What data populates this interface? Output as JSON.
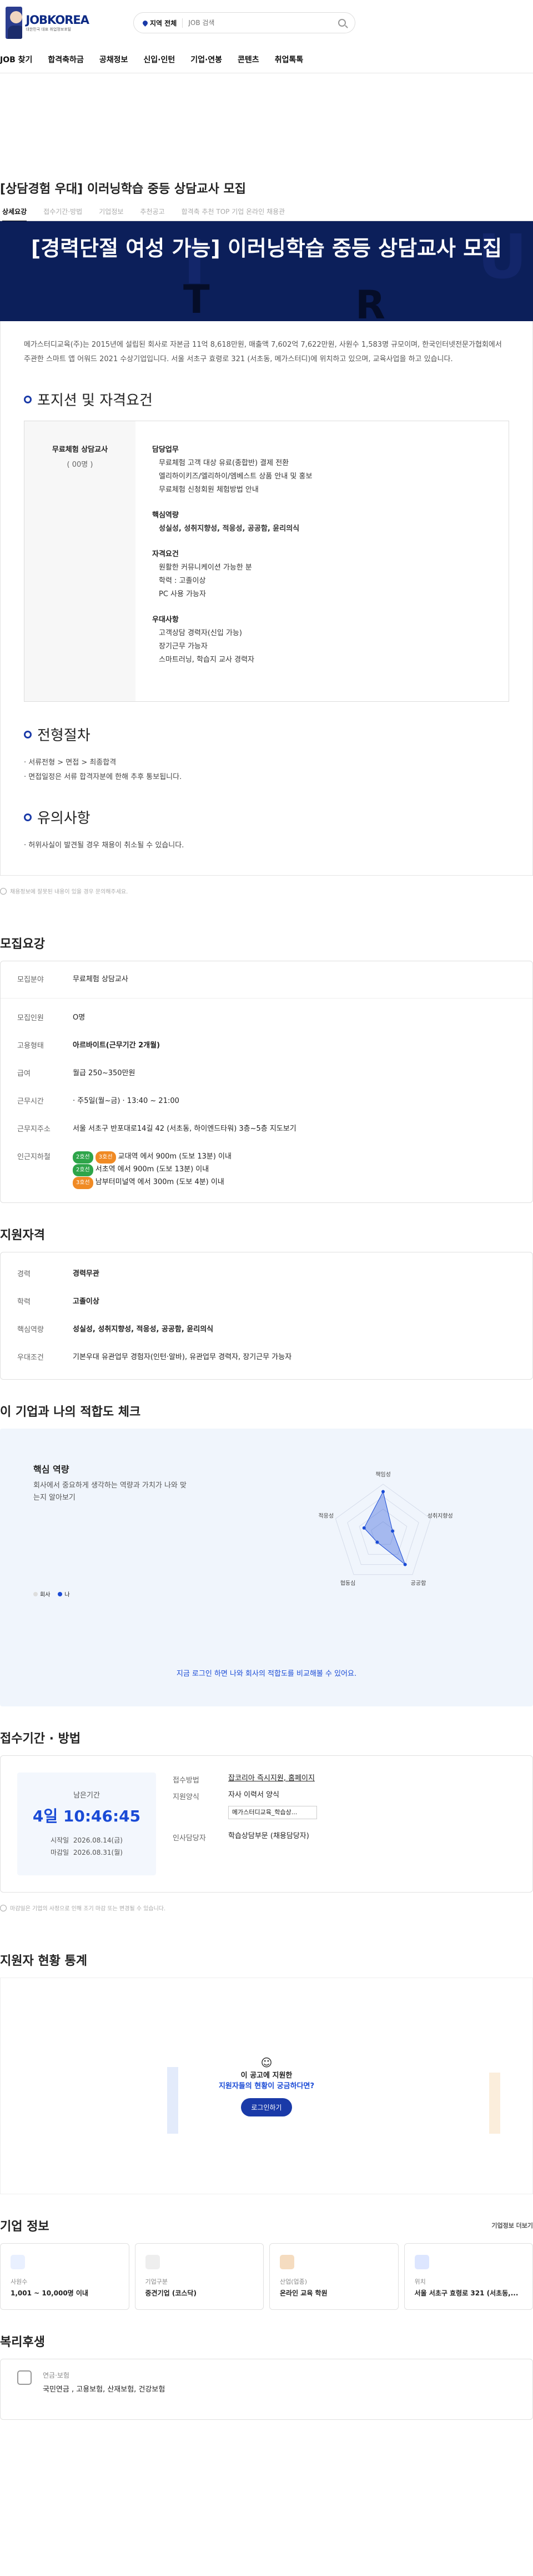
{
  "header": {
    "brand": "JOBKOREA",
    "slogan": "대한민국 대표 취업정보포털",
    "region": "지역 전체",
    "search_placeholder": "JOB 검색"
  },
  "gnb": [
    "JOB 찾기",
    "합격축하금",
    "공채정보",
    "신입·인턴",
    "기업·연봉",
    "콘텐츠",
    "취업톡톡"
  ],
  "job": {
    "title": "[상담경험 우대] 이러닝학습 중등 상담교사 모집",
    "tabs": [
      "상세요강",
      "접수기간·방법",
      "기업정보",
      "추천공고",
      "합격축 추천 TOP 기업 온라인 채용관"
    ]
  },
  "banner": {
    "title": "[경력단절 여성 가능] 이러닝학습 중등 상담교사 모집",
    "letters": [
      "T",
      "R",
      "U"
    ]
  },
  "intro": "메가스터디교육(주)는 2015년에 설립된 회사로 자본금 11억 8,618만원, 매출액 7,602억 7,622만원, 사원수 1,583명 규모이며, 한국인터넷전문가협회에서 주관한 스마트 앱 어워드 2021 수상기업입니다. 서울 서초구 효령로 321 (서초동, 메가스터디)에 위치하고 있으며, 교육사업을 하고 있습니다.",
  "position": {
    "heading": "포지션 및 자격요건",
    "name": "무료체험 상담교사",
    "count": "( 00명 )",
    "blocks": [
      {
        "title": "담당업무",
        "items": [
          "무료체험 고객 대상 유료(종합반) 결제 전환",
          "엘리하이키즈/엘리하이/엠베스트 상품 안내 및 홍보",
          "무료체험 신청회원 체험방법 안내"
        ]
      },
      {
        "title": "핵심역량",
        "items": [
          "성실성, 성취지향성, 적응성, 공공함, 윤리의식"
        ]
      },
      {
        "title": "자격요건",
        "items": [
          "원활한 커뮤니케이션 가능한 분",
          "학력 : 고졸이상",
          "PC 사용 가능자"
        ]
      },
      {
        "title": "우대사항",
        "items": [
          "고객상담 경력자(신입 가능)",
          "장기근무 가능자",
          "스마트러닝, 학습지 교사 경력자"
        ]
      }
    ]
  },
  "process": {
    "heading": "전형절차",
    "lines": [
      "· 서류전형 > 면접 > 최종합격",
      "· 면접일정은 서류 합격자분에 한해 추후 통보됩니다."
    ]
  },
  "notes": {
    "heading": "유의사항",
    "lines": [
      "· 허위사실이 발견될 경우 채용이 취소될 수 있습니다."
    ],
    "report": "채용정보에 잘못된 내용이 있을 경우 문의해주세요."
  },
  "summary": {
    "heading": "모집요강",
    "rows": [
      {
        "k": "모집분야",
        "v": "무료체험 상담교사"
      },
      {
        "k": "모집인원",
        "v": "O명"
      },
      {
        "k": "고용형태",
        "v": "아르바이트(근무기간 2개월)"
      },
      {
        "k": "급여",
        "v": "월급 250~350만원"
      },
      {
        "k": "근무시간",
        "v": "· 주5일(월~금)  · 13:40 ~ 21:00"
      },
      {
        "k": "근무지주소",
        "v": "서울 서초구 반포대로14길 42 (서초동, 하이엔드타워) 3층~5층  지도보기"
      }
    ],
    "station_label": "인근지하철",
    "stations": [
      {
        "line": "2호선",
        "sub": "3호선",
        "text": "교대역 에서 900m (도보 13분) 이내"
      },
      {
        "line": "2호선",
        "text": "서초역 에서 900m (도보 13분) 이내"
      },
      {
        "line": "3호선",
        "text": "남부터미널역 에서 300m (도보 4분) 이내"
      }
    ]
  },
  "qualify": {
    "heading": "지원자격",
    "rows": [
      {
        "k": "경력",
        "v": "경력무관"
      },
      {
        "k": "학력",
        "v": "고졸이상"
      },
      {
        "k": "핵심역량",
        "v": "성실성, 성취지향성, 적응성, 공공함, 윤리의식"
      },
      {
        "k": "우대조건",
        "v": "기본우대  유관업무 경험자(인턴·알바), 유관업무 경력자, 장기근무 가능자"
      }
    ]
  },
  "fit": {
    "heading": "이 기업과 나의 적합도 체크",
    "title": "핵심 역량",
    "desc": "회사에서 중요하게 생각하는 역량과 가치가 나와 맞는지 알아보기",
    "axes": [
      "책임성",
      "성취지향성",
      "공공함",
      "협동심",
      "적응성"
    ],
    "legend_company": "회사",
    "legend_me": "나",
    "company_values": [
      0.85,
      0.2,
      0.75,
      0.2,
      0.4
    ],
    "footer": "지금 로그인 하면 나와 회사의 적합도를 비교해볼 수 있어요."
  },
  "apply": {
    "heading": "접수기간 · 방법",
    "remain_label": "남은기간",
    "remain": "4일 10:46:45",
    "start_label": "시작일",
    "start": "2026.08.14(금)",
    "end_label": "마감일",
    "end": "2026.08.31(월)",
    "rows": [
      {
        "k": "접수방법",
        "v": "잡코리아 즉시지원, 홈페이지"
      },
      {
        "k": "지원양식",
        "v": "자사 이력서 양식"
      },
      {
        "k": "",
        "v": "메가스터디교육_학습상..."
      },
      {
        "k": "인사담당자",
        "v": "학습상담부문 (채용담당자)"
      }
    ],
    "note": "마감일은 기업의 사정으로 인해 조기 마감 또는 변경될 수 있습니다."
  },
  "stats": {
    "heading": "지원자 현황 통계",
    "q1": "이 공고에 지원한",
    "q2": "지원자들의 현황이 궁금하다면?",
    "btn": "로그인하기"
  },
  "company": {
    "heading": "기업 정보",
    "more": "기업정보 더보기",
    "boxes": [
      {
        "lab": "사원수",
        "val": "1,001 ~ 10,000명 이내"
      },
      {
        "lab": "기업구분",
        "val": "중견기업 (코스닥)"
      },
      {
        "lab": "산업(업종)",
        "val": "온라인 교육 학원"
      },
      {
        "lab": "위치",
        "val": "서울 서초구 효령로 321 (서초동,..."
      }
    ]
  },
  "welfare": {
    "heading": "복리후생",
    "lab": "연금·보험",
    "val": "국민연금 , 고용보험, 산재보험, 건강보험"
  }
}
